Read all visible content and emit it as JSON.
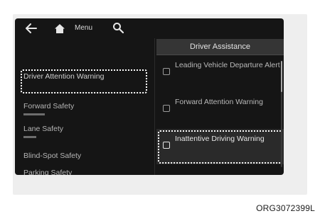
{
  "nav": {
    "back_icon": "back-arrow-icon",
    "home_icon": "home-icon",
    "menu_label": "Menu",
    "search_icon": "search-icon"
  },
  "left_menu": {
    "items": [
      {
        "label": "Driver Attention Warning",
        "selected": true
      },
      {
        "label": "Forward Safety"
      },
      {
        "label": "Lane Safety"
      },
      {
        "label": "Blind-Spot Safety"
      },
      {
        "label": "Parking Safety"
      }
    ]
  },
  "right_panel": {
    "title": "Driver Assistance",
    "options": [
      {
        "label": "Leading Vehicle Departure Alert",
        "checked": false
      },
      {
        "label": "Forward Attention Warning",
        "checked": false
      },
      {
        "label": "Inattentive Driving Warning",
        "checked": false,
        "highlighted": true
      }
    ]
  },
  "caption": "ORG3072399L"
}
